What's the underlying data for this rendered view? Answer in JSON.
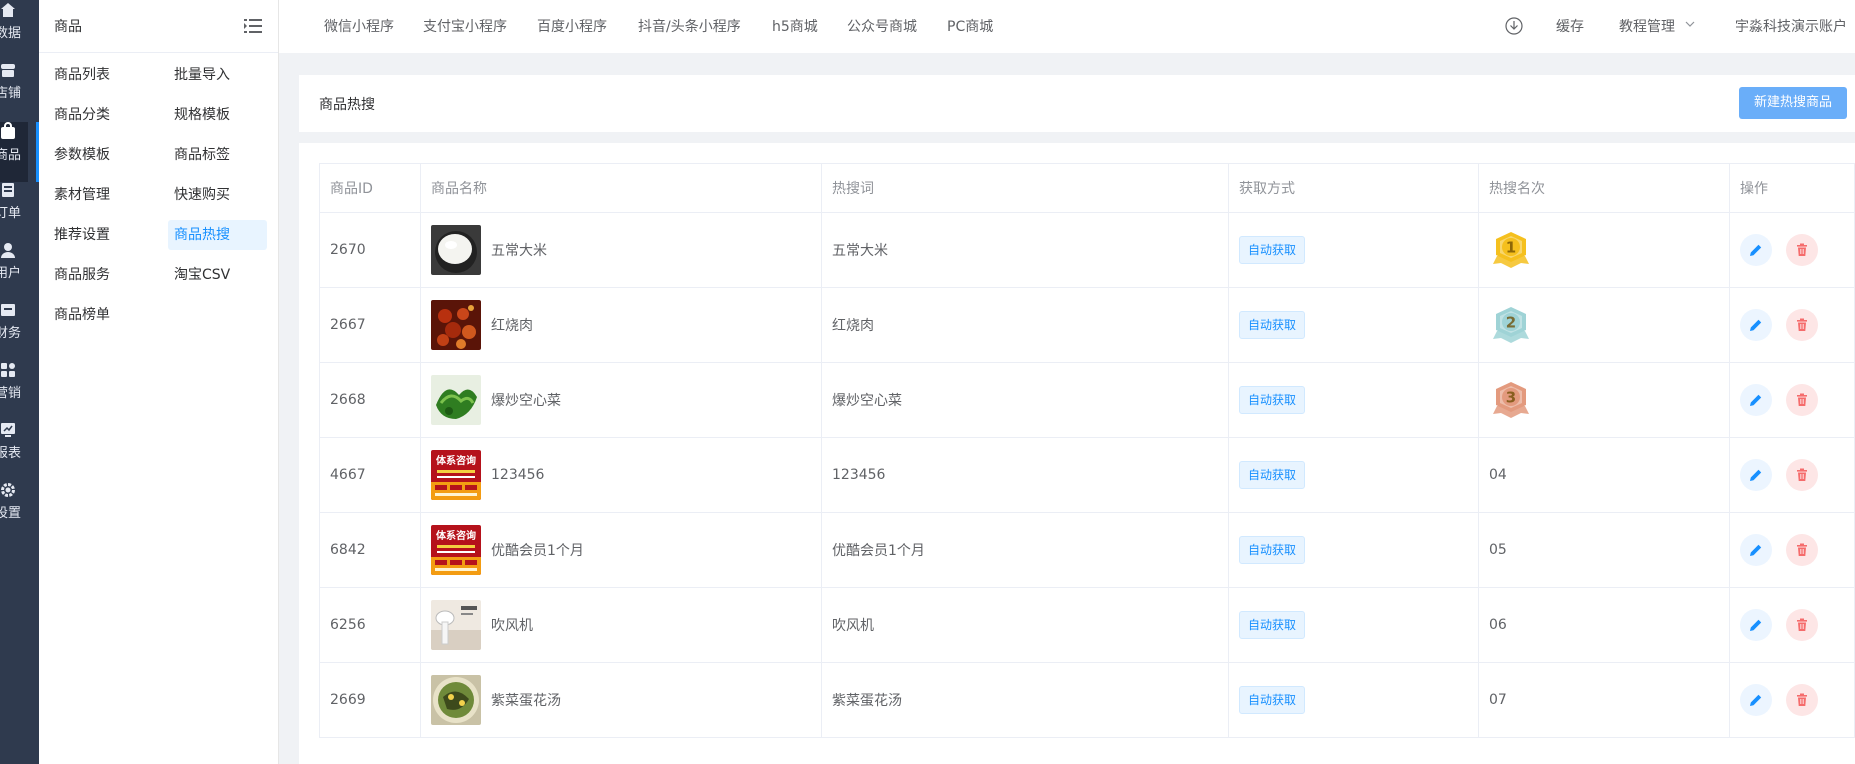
{
  "rail": {
    "items": [
      {
        "label": "数据",
        "icon": "home-icon"
      },
      {
        "label": "店铺",
        "icon": "shop-icon"
      },
      {
        "label": "商品",
        "icon": "bag-icon"
      },
      {
        "label": "订单",
        "icon": "order-icon"
      },
      {
        "label": "用户",
        "icon": "user-icon"
      },
      {
        "label": "财务",
        "icon": "finance-icon"
      },
      {
        "label": "营销",
        "icon": "apps-icon"
      },
      {
        "label": "报表",
        "icon": "chart-icon"
      },
      {
        "label": "设置",
        "icon": "gear-icon"
      }
    ],
    "active_index": 2
  },
  "submenu": {
    "title": "商品",
    "items": [
      "商品列表",
      "批量导入",
      "商品分类",
      "规格模板",
      "参数模板",
      "商品标签",
      "素材管理",
      "快速购买",
      "推荐设置",
      "商品热搜",
      "商品服务",
      "淘宝CSV",
      "商品榜单"
    ],
    "active": "商品热搜"
  },
  "topbar": {
    "tabs": [
      "微信小程序",
      "支付宝小程序",
      "百度小程序",
      "抖音/头条小程序",
      "h5商城",
      "公众号商城",
      "PC商城"
    ],
    "cache": "缓存",
    "tutorial": "教程管理",
    "account": "宇淼科技演示账户"
  },
  "header": {
    "title": "商品热搜",
    "new_button": "新建热搜商品"
  },
  "table": {
    "columns": [
      "商品ID",
      "商品名称",
      "热搜词",
      "获取方式",
      "热搜名次",
      "操作"
    ],
    "rows": [
      {
        "id": "2670",
        "name": "五常大米",
        "keyword": "五常大米",
        "method": "自动获取",
        "rank": "1",
        "thumb": "rice"
      },
      {
        "id": "2667",
        "name": "红烧肉",
        "keyword": "红烧肉",
        "method": "自动获取",
        "rank": "2",
        "thumb": "pork"
      },
      {
        "id": "2668",
        "name": "爆炒空心菜",
        "keyword": "爆炒空心菜",
        "method": "自动获取",
        "rank": "3",
        "thumb": "greens"
      },
      {
        "id": "4667",
        "name": "123456",
        "keyword": "123456",
        "method": "自动获取",
        "rank": "04",
        "thumb": "poster"
      },
      {
        "id": "6842",
        "name": "优酷会员1个月",
        "keyword": "优酷会员1个月",
        "method": "自动获取",
        "rank": "05",
        "thumb": "poster"
      },
      {
        "id": "6256",
        "name": "吹风机",
        "keyword": "吹风机",
        "method": "自动获取",
        "rank": "06",
        "thumb": "dryer"
      },
      {
        "id": "2669",
        "name": "紫菜蛋花汤",
        "keyword": "紫菜蛋花汤",
        "method": "自动获取",
        "rank": "07",
        "thumb": "soup"
      }
    ],
    "poster_text": "体系咨询"
  },
  "colors": {
    "accent": "#1890ff",
    "rail_bg": "#2f3a4e",
    "delete": "#f56c6c",
    "gold": "#f5c01e",
    "silver": "#9fd3d6",
    "bronze": "#e39a7e"
  }
}
